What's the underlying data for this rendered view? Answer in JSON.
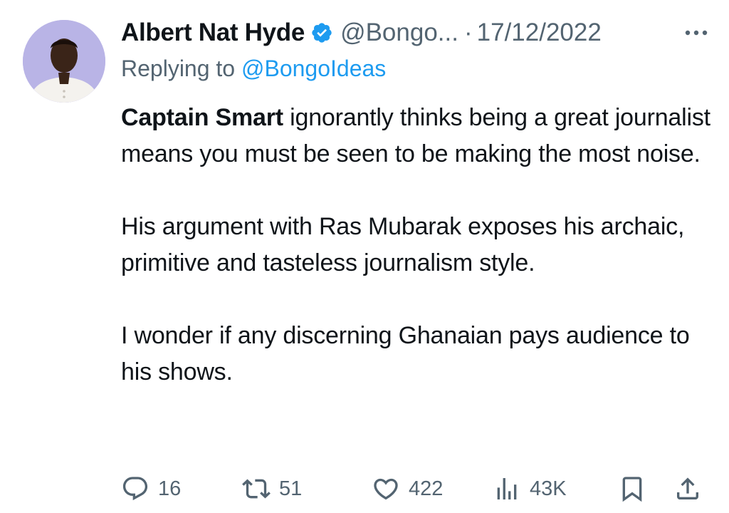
{
  "tweet": {
    "author": {
      "name": "Albert Nat Hyde",
      "handle": "@Bongo...",
      "date": "17/12/2022",
      "separator": "·",
      "verified_icon": "verified-badge-icon"
    },
    "replying_prefix": "Replying to ",
    "replying_to": "@BongoIdeas",
    "body": {
      "p1_bold": "Captain Smart",
      "p1_rest": " ignorantly thinks being a great journalist means you must be seen to be making the most noise.",
      "p2": "His argument with Ras Mubarak exposes his archaic, primitive and tasteless journalism style.",
      "p3": "I wonder if any discerning Ghanaian pays audience to his shows."
    },
    "actions": {
      "replies": "16",
      "retweets": "51",
      "likes": "422",
      "views": "43K"
    }
  },
  "colors": {
    "text": "#0f1419",
    "secondary": "#536471",
    "link": "#1d9bf0",
    "avatar_bg": "#b9b4e6"
  }
}
